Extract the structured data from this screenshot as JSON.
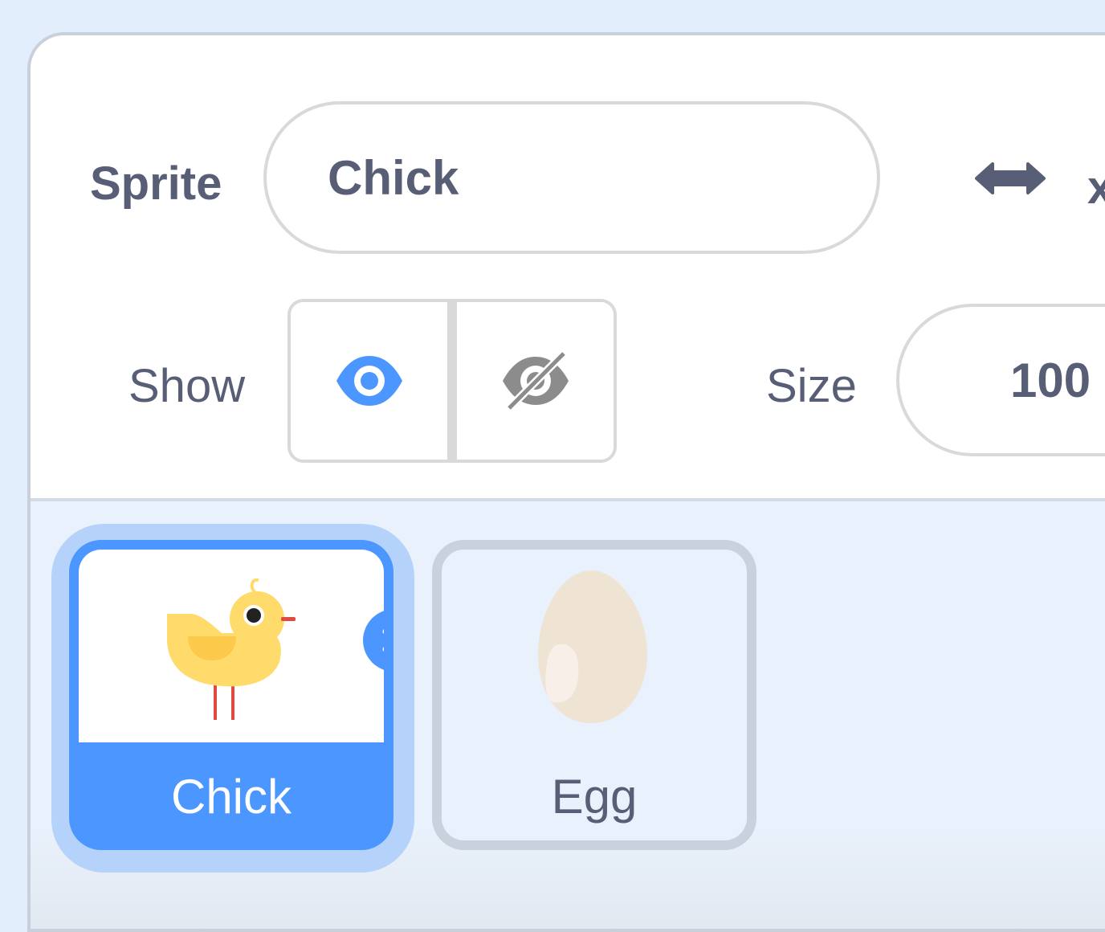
{
  "sprite_info": {
    "sprite_label": "Sprite",
    "sprite_name": "Chick",
    "x_label": "x",
    "show_label": "Show",
    "size_label": "Size",
    "size_value": "100",
    "visible": true
  },
  "sprites": [
    {
      "name": "Chick",
      "selected": true,
      "icon": "chick-costume-icon"
    },
    {
      "name": "Egg",
      "selected": false,
      "icon": "egg-costume-icon"
    }
  ],
  "colors": {
    "accent": "#4c97ff",
    "text": "#575e75",
    "selected_halo": "#b5d2fb",
    "background": "#e9f1fc"
  }
}
